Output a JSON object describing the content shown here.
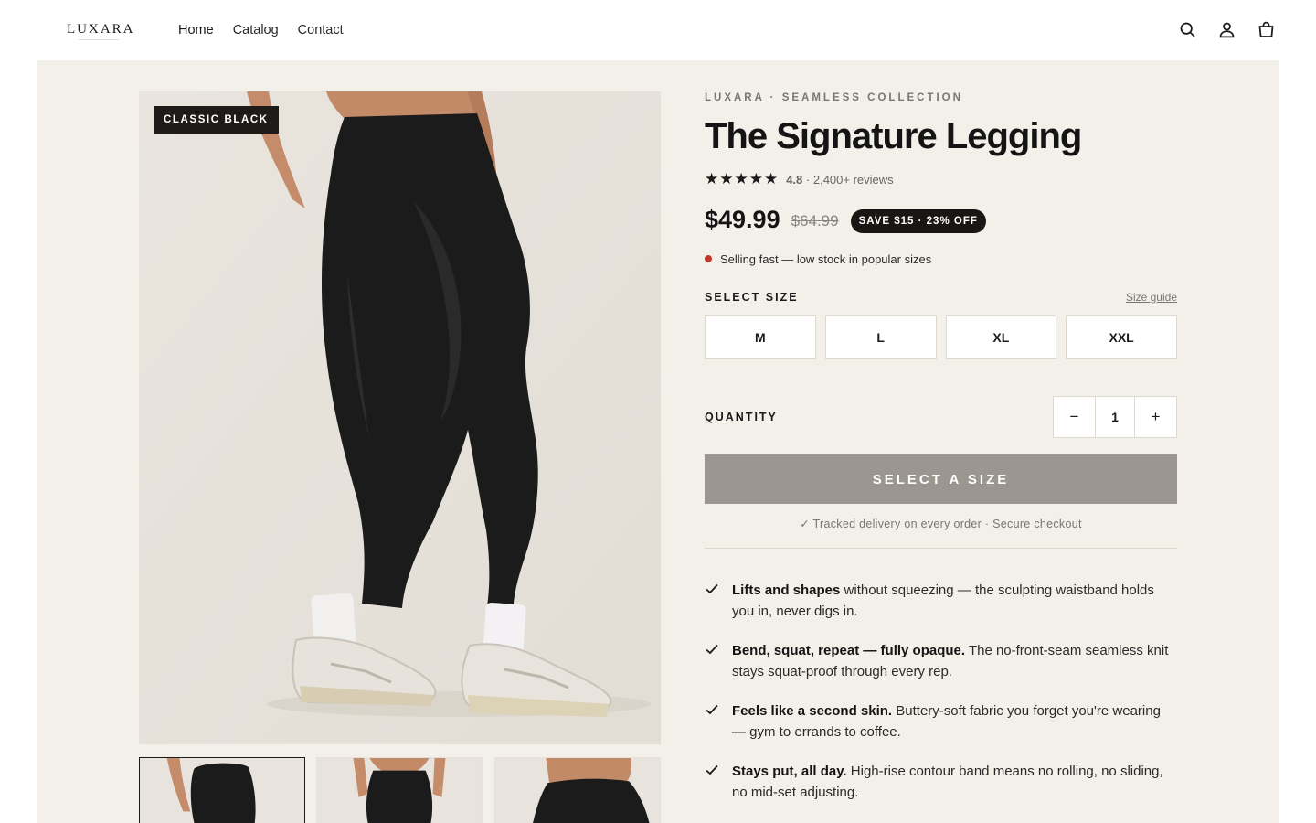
{
  "header": {
    "logo": "LUXARA",
    "nav": [
      "Home",
      "Catalog",
      "Contact"
    ],
    "icons": [
      "search-icon",
      "account-icon",
      "cart-icon"
    ]
  },
  "gallery": {
    "badge": "CLASSIC BLACK",
    "thumbnails": [
      "thumb-1",
      "thumb-2",
      "thumb-3"
    ],
    "selected_thumbnail": 0
  },
  "product": {
    "eyebrow": "LUXARA · SEAMLESS COLLECTION",
    "title": "The Signature Legging",
    "stars": "★★★★★",
    "rating": "4.8",
    "reviews": "· 2,400+ reviews",
    "price": "$49.99",
    "compare_price": "$64.99",
    "save_badge": "SAVE $15 · 23% OFF",
    "stock_note": "Selling fast — low stock in popular sizes",
    "size_label": "SELECT SIZE",
    "size_guide": "Size guide",
    "sizes": [
      "M",
      "L",
      "XL",
      "XXL"
    ],
    "quantity_label": "QUANTITY",
    "quantity": "1",
    "minus": "−",
    "plus": "+",
    "cta": "SELECT A SIZE",
    "assurance": "✓ Tracked delivery on every order · Secure checkout",
    "features": [
      {
        "bold": "Lifts and shapes",
        "text": " without squeezing — the sculpting waistband holds you in, never digs in."
      },
      {
        "bold": "Bend, squat, repeat — fully opaque.",
        "text": " The no-front-seam seamless knit stays squat-proof through every rep."
      },
      {
        "bold": "Feels like a second skin.",
        "text": " Buttery-soft fabric you forget you're wearing — gym to errands to coffee."
      },
      {
        "bold": "Stays put, all day.",
        "text": " High-rise contour band means no rolling, no sliding, no mid-set adjusting."
      }
    ]
  },
  "colors": {
    "page_bg": "#f3f0ea",
    "text": "#141414",
    "muted": "#7a7570",
    "cta_disabled": "#9b9690",
    "stock_dot": "#c0392b",
    "badge_bg": "#1a1614"
  }
}
